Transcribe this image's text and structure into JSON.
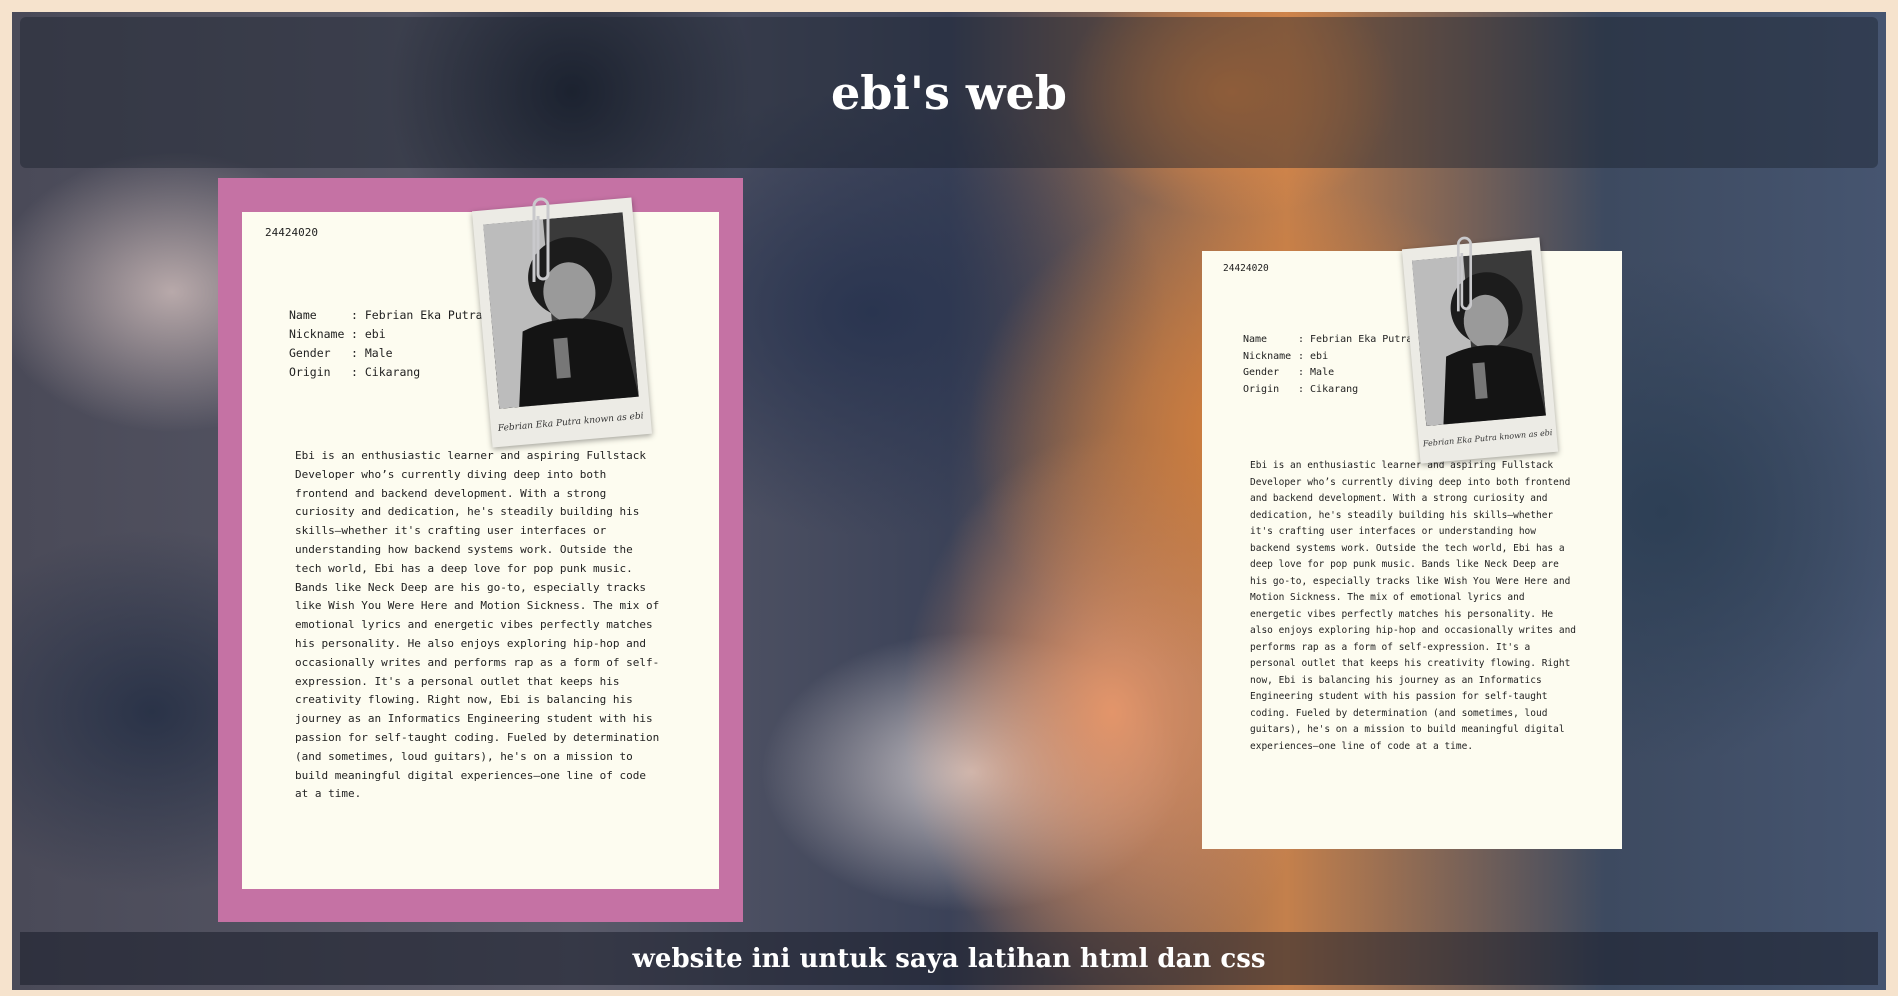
{
  "header": {
    "title": "ebi's web"
  },
  "footer": {
    "text": "website ini untuk saya latihan html dan css"
  },
  "profile": {
    "id_number": "24424020",
    "fields": [
      {
        "label": "Name",
        "value": ": Febrian Eka Putra"
      },
      {
        "label": "Nickname",
        "value": ": ebi"
      },
      {
        "label": "Gender",
        "value": ": Male"
      },
      {
        "label": "Origin",
        "value": ": Cikarang"
      }
    ],
    "photo_caption": "Febrian Eka Putra known as ebi",
    "bio": "Ebi is an enthusiastic learner and aspiring Fullstack Developer who’s currently diving deep into both frontend and backend development. With a strong curiosity and dedication, he's steadily building his skills—whether it's crafting user interfaces or understanding how backend systems work. Outside the tech world, Ebi has a deep love for pop punk music. Bands like Neck Deep are his go-to, especially tracks like Wish You Were Here and Motion Sickness. The mix of emotional lyrics and energetic vibes perfectly matches his personality. He also enjoys exploring hip-hop and occasionally writes and performs rap as a form of self-expression. It's a personal outlet that keeps his creativity flowing. Right now, Ebi is balancing his journey as an Informatics Engineering student with his passion for self-taught coding. Fueled by determination (and sometimes, loud guitars), he's on a mission to build meaningful digital experiences—one line of code at a time."
  },
  "colors": {
    "card_accent": "#c572a4",
    "paper": "#fdfcf0",
    "page_border": "#f6e3cd"
  },
  "icons": [
    "paperclip-icon"
  ]
}
